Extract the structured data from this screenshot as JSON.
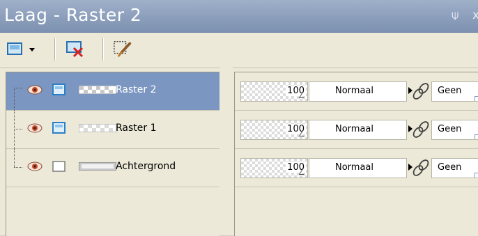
{
  "panel": {
    "title": "Laag - Raster 2",
    "pin_glyph": "⍦",
    "close_glyph": "x"
  },
  "toolbar": {
    "new_layer_icon": "new-layer-icon",
    "delete_layer_icon": "delete-layer-icon",
    "layer_properties_icon": "layer-properties-icon"
  },
  "colors": {
    "title_bar": "#8da0bd",
    "selected_row": "#7b96c0",
    "panel_bg": "#ece9d8"
  },
  "layers": [
    {
      "name": "Raster 2",
      "selected": true,
      "opacity": "100",
      "blend_mode": "Normaal",
      "link": "Geen"
    },
    {
      "name": "Raster 1",
      "selected": false,
      "opacity": "100",
      "blend_mode": "Normaal",
      "link": "Geen"
    },
    {
      "name": "Achtergrond",
      "selected": false,
      "opacity": "100",
      "blend_mode": "Normaal",
      "link": "Geen"
    }
  ]
}
